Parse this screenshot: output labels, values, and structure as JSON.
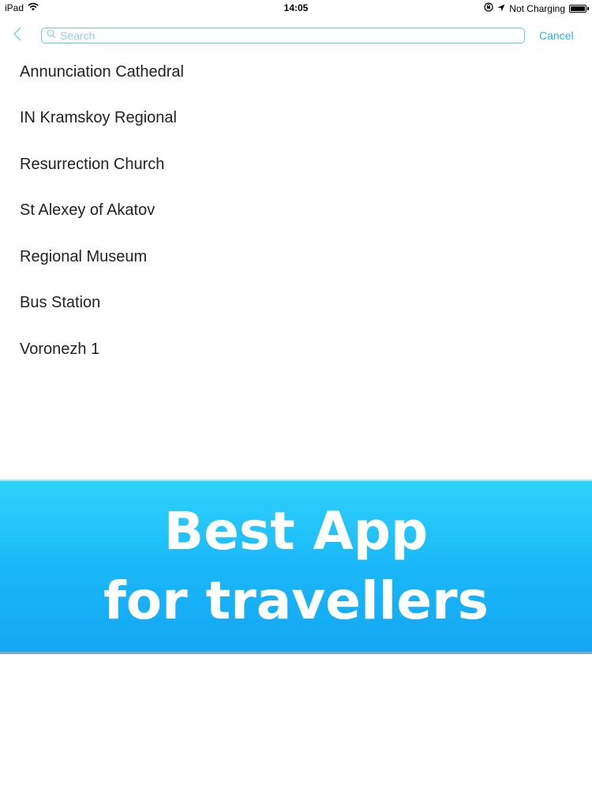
{
  "status_bar": {
    "device": "iPad",
    "time": "14:05",
    "charging": "Not Charging"
  },
  "search": {
    "placeholder": "Search",
    "value": "",
    "cancel_label": "Cancel"
  },
  "results": [
    "Annunciation Cathedral",
    "IN Kramskoy Regional",
    "Resurrection Church",
    "St Alexey of Akatov",
    "Regional Museum",
    "Bus Station",
    "Voronezh 1"
  ],
  "banner": {
    "line1": "Best App",
    "line2": "for travellers"
  },
  "colors": {
    "accent": "#2cb3de",
    "banner_top": "#2ed3fb",
    "banner_bottom": "#14a6f3"
  },
  "icons": [
    "wifi-icon",
    "orientation-lock-icon",
    "location-arrow-icon",
    "battery-icon",
    "back-chevron-icon",
    "search-icon"
  ]
}
